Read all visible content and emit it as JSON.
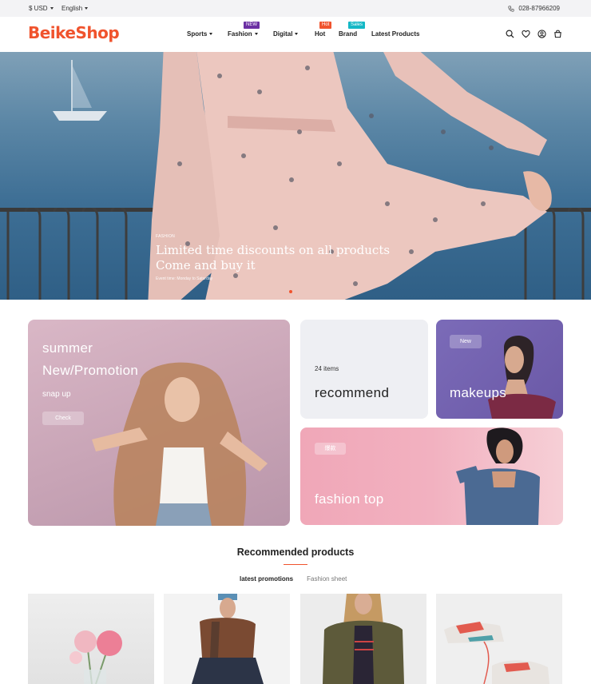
{
  "topbar": {
    "currency": "$ USD",
    "language": "English",
    "phone": "028-87966209"
  },
  "header": {
    "logo": "BeikeShop",
    "nav": [
      {
        "label": "Sports",
        "has_dropdown": true
      },
      {
        "label": "Fashion",
        "has_dropdown": true,
        "badge": "NEW",
        "badge_color": "#6b2fa3"
      },
      {
        "label": "Digital",
        "has_dropdown": true
      },
      {
        "label": "Hot",
        "badge": "Hot",
        "badge_color": "#f0532d"
      },
      {
        "label": "Brand",
        "badge": "Sales",
        "badge_color": "#14b8c6"
      },
      {
        "label": "Latest Products"
      }
    ],
    "icons": [
      "search-icon",
      "heart-icon",
      "user-icon",
      "cart-icon"
    ]
  },
  "hero": {
    "subtitle": "FASHION",
    "title_line1": "Limited time discounts on all products",
    "title_line2": "Come and buy it",
    "event_time": "Event time: Monday to Saturday"
  },
  "promos": {
    "summer": {
      "title_line1": "summer",
      "title_line2": "New/Promotion",
      "subtitle": "snap up",
      "button": "Check"
    },
    "recommend": {
      "count": "24 items",
      "title": "recommend"
    },
    "makeups": {
      "tag": "New",
      "title": "makeups"
    },
    "fashion": {
      "tag": "爆款",
      "title": "fashion top"
    }
  },
  "recommended": {
    "heading": "Recommended products",
    "tabs": [
      "latest promotions",
      "Fashion sheet"
    ]
  },
  "colors": {
    "brand": "#f0532d",
    "topbar_bg": "#f3f3f5"
  }
}
